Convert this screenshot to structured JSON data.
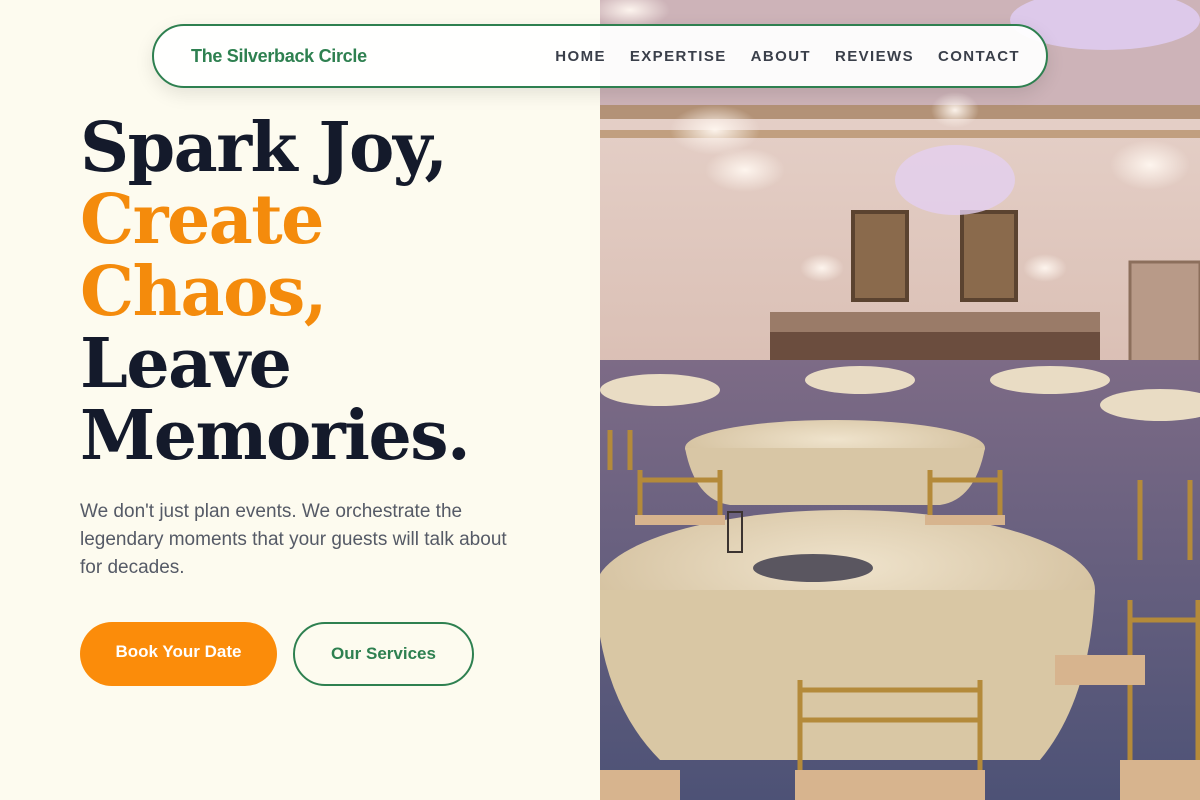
{
  "brand": {
    "name": "The Silverback Circle"
  },
  "nav": {
    "items": [
      "HOME",
      "EXPERTISE",
      "ABOUT",
      "REVIEWS",
      "CONTACT"
    ]
  },
  "hero": {
    "line1": "Spark Joy,",
    "line2": "Create",
    "line3": "Chaos,",
    "line4": "Leave",
    "line5": "Memories.",
    "lead": "We don't just plan events. We orchestrate the legendary moments that your guests will talk about for decades.",
    "primary_cta": "Book Your Date",
    "secondary_cta": "Our Services"
  },
  "colors": {
    "page_bg": "#fdfbef",
    "brand_green": "#2e8050",
    "accent_orange": "#f48b0c",
    "button_orange": "#fb8c0a",
    "heading_dark": "#141a2b",
    "body_gray": "#555a66"
  },
  "image": {
    "subject": "banquet-hall-photo"
  }
}
